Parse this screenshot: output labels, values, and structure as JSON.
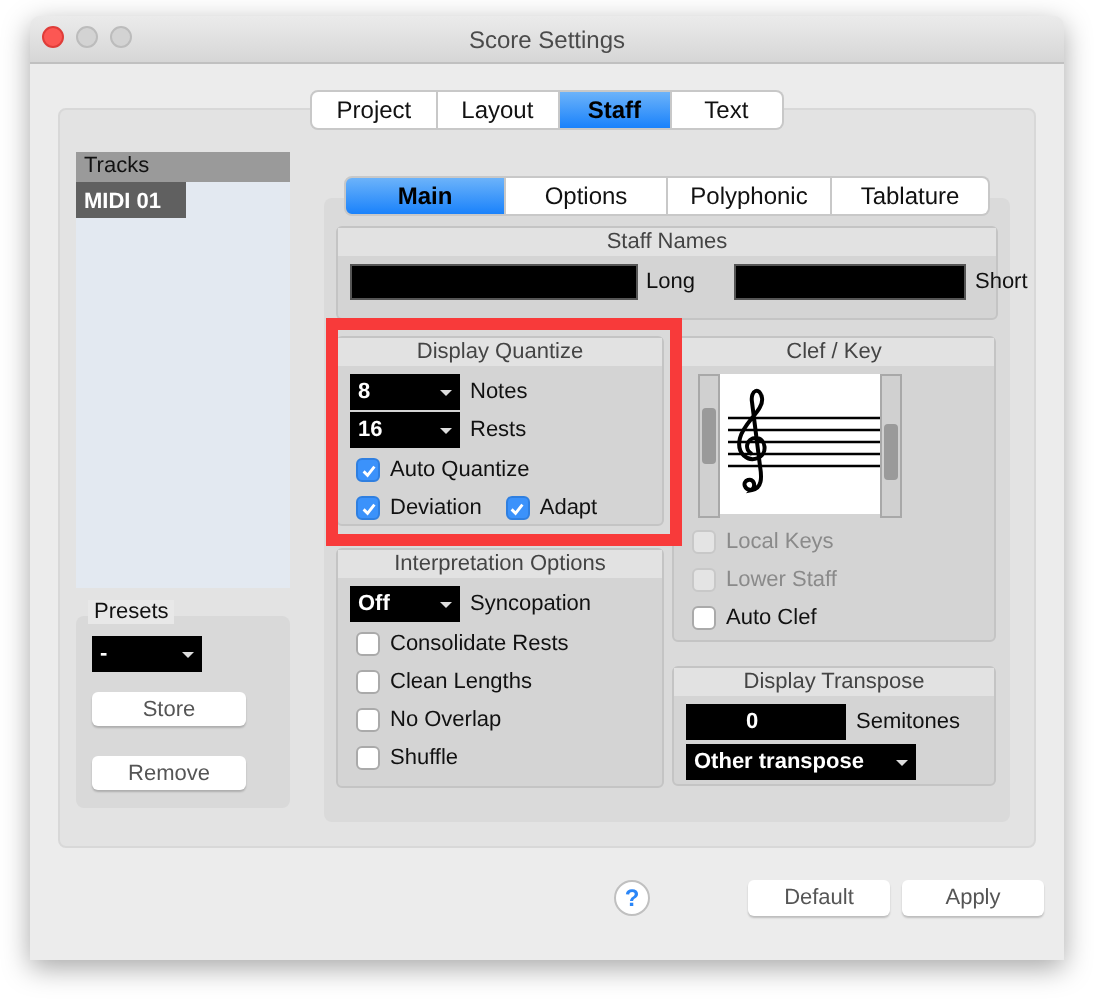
{
  "window": {
    "title": "Score Settings"
  },
  "tabs": [
    {
      "label": "Project",
      "selected": false
    },
    {
      "label": "Layout",
      "selected": false
    },
    {
      "label": "Staff",
      "selected": true
    },
    {
      "label": "Text",
      "selected": false
    }
  ],
  "tracks": {
    "header": "Tracks",
    "items": [
      {
        "label": "MIDI 01",
        "selected": true
      }
    ]
  },
  "presets": {
    "title": "Presets",
    "value": "-",
    "buttons": [
      "Store",
      "Remove"
    ]
  },
  "subtabs": [
    {
      "label": "Main",
      "selected": true
    },
    {
      "label": "Options",
      "selected": false
    },
    {
      "label": "Polyphonic",
      "selected": false
    },
    {
      "label": "Tablature",
      "selected": false
    }
  ],
  "staff_names": {
    "title": "Staff Names",
    "fields": [
      {
        "label": "Long"
      },
      {
        "label": "Short"
      }
    ]
  },
  "display_quantize": {
    "title": "Display Quantize",
    "selects": [
      {
        "value": "8",
        "label": "Notes"
      },
      {
        "value": "16",
        "label": "Rests"
      }
    ],
    "check_rows": [
      [
        {
          "label": "Auto Quantize",
          "checked": true
        }
      ],
      [
        {
          "label": "Deviation",
          "checked": true
        },
        {
          "label": "Adapt",
          "checked": true
        }
      ]
    ]
  },
  "interpretation": {
    "title": "Interpretation Options",
    "select": {
      "value": "Off",
      "label": "Syncopation"
    },
    "checks": [
      {
        "label": "Consolidate Rests",
        "checked": false
      },
      {
        "label": "Clean Lengths",
        "checked": false
      },
      {
        "label": "No Overlap",
        "checked": false
      },
      {
        "label": "Shuffle",
        "checked": false
      }
    ]
  },
  "clef_key": {
    "title": "Clef / Key",
    "checks": [
      {
        "label": "Local Keys",
        "checked": false,
        "disabled": true
      },
      {
        "label": "Lower Staff",
        "checked": false,
        "disabled": true
      },
      {
        "label": "Auto Clef",
        "checked": false,
        "disabled": false
      }
    ]
  },
  "display_transpose": {
    "title": "Display Transpose",
    "value": "0",
    "label": "Semitones",
    "select": "Other transpose"
  },
  "help": "?",
  "buttons": [
    "Default",
    "Apply"
  ]
}
